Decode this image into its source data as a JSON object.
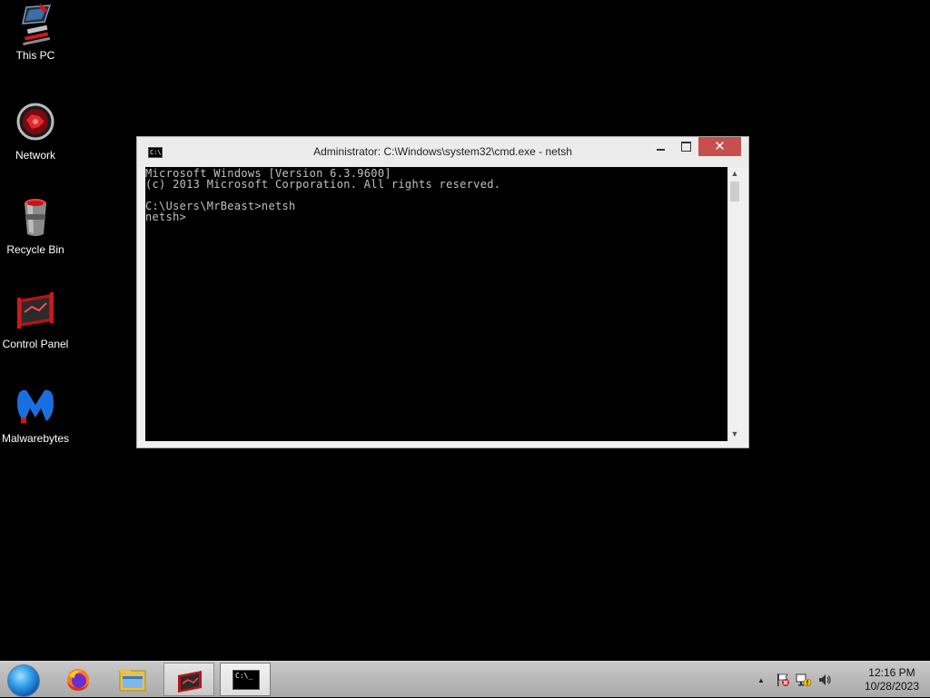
{
  "desktop": {
    "icons": [
      {
        "label": "This PC",
        "icon": "this-pc-icon"
      },
      {
        "label": "Network",
        "icon": "network-icon"
      },
      {
        "label": "Recycle Bin",
        "icon": "recycle-bin-icon"
      },
      {
        "label": "Control Panel",
        "icon": "control-panel-icon"
      },
      {
        "label": "Malwarebytes",
        "icon": "malwarebytes-icon"
      }
    ]
  },
  "window": {
    "title": "Administrator: C:\\Windows\\system32\\cmd.exe - netsh",
    "icon_text": "C:\\",
    "close_glyph": "✕",
    "console_lines": [
      "Microsoft Windows [Version 6.3.9600]",
      "(c) 2013 Microsoft Corporation. All rights reserved.",
      "",
      "C:\\Users\\MrBeast>netsh",
      "netsh>"
    ],
    "scroll_up_glyph": "▲",
    "scroll_down_glyph": "▼"
  },
  "taskbar": {
    "buttons": [
      {
        "name": "start-button",
        "icon": "windows-orb-icon"
      },
      {
        "name": "firefox",
        "icon": "firefox-icon"
      },
      {
        "name": "file-explorer",
        "icon": "folder-icon"
      },
      {
        "name": "control-panel",
        "icon": "control-panel-icon"
      },
      {
        "name": "command-prompt",
        "icon": "cmd-icon"
      }
    ],
    "cmd_icon_text": "C:\\_",
    "tray": {
      "chevron": "▲",
      "time": "12:16 PM",
      "date": "10/28/2023"
    }
  },
  "colors": {
    "desktop_bg": "#000000",
    "accent_red": "#d1171e",
    "close_button": "#c7504f",
    "console_text": "#c0c0c0"
  }
}
